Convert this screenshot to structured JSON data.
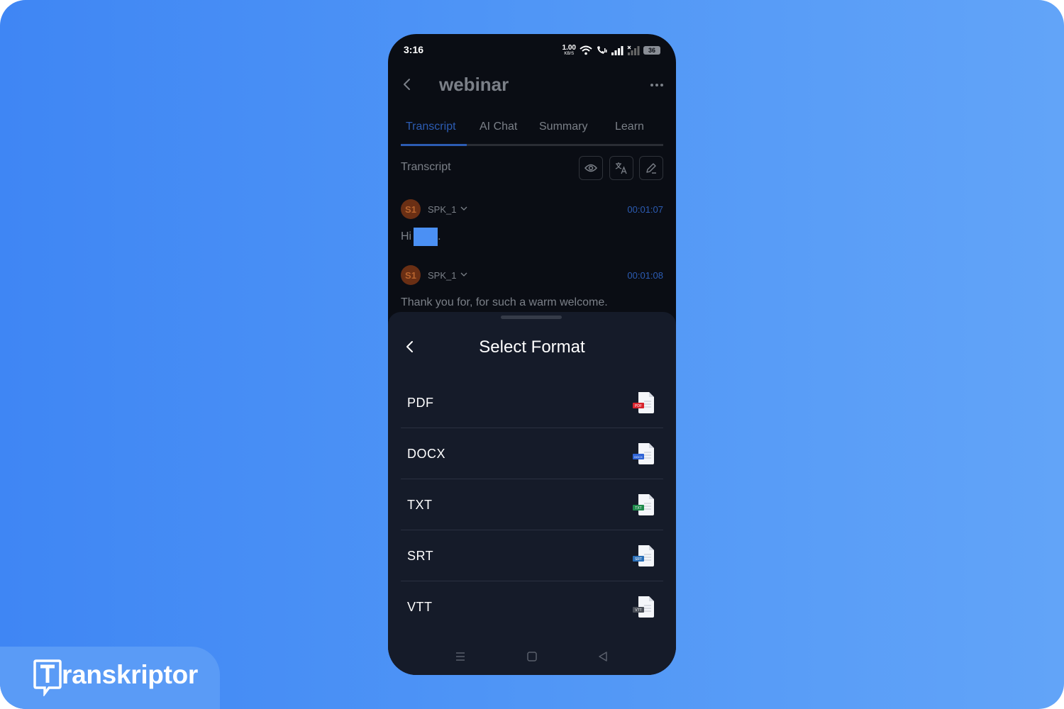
{
  "brand": {
    "name": "Transkriptor",
    "logo_letter": "T",
    "logo_rest": "ranskriptor"
  },
  "status_bar": {
    "time": "3:16",
    "net_speed": "1.00",
    "net_unit": "KB/S",
    "battery": "36"
  },
  "header": {
    "title": "webinar",
    "back_icon": "chevron-left-icon",
    "more_icon": "more-horizontal-icon"
  },
  "tabs": [
    {
      "label": "Transcript",
      "active": true
    },
    {
      "label": "AI Chat",
      "active": false
    },
    {
      "label": "Summary",
      "active": false
    },
    {
      "label": "Learn",
      "active": false
    }
  ],
  "transcript_section": {
    "label": "Transcript",
    "tools": [
      "eye-icon",
      "translate-icon",
      "edit-icon"
    ]
  },
  "entries": [
    {
      "avatar": "S1",
      "speaker": "SPK_1",
      "timestamp": "00:01:07",
      "text_before": "Hi",
      "text_after": ".",
      "redacted": true
    },
    {
      "avatar": "S1",
      "speaker": "SPK_1",
      "timestamp": "00:01:08",
      "text": "Thank you for, for such a warm welcome."
    }
  ],
  "sheet": {
    "title": "Select Format",
    "formats": [
      {
        "label": "PDF",
        "badge": "PDF",
        "badge_color": "#d8242d"
      },
      {
        "label": "DOCX",
        "badge": "DOCX",
        "badge_color": "#2f64d6"
      },
      {
        "label": "TXT",
        "badge": "TXT",
        "badge_color": "#1f8a4c"
      },
      {
        "label": "SRT",
        "badge": "SRT",
        "badge_color": "#2a6fb8"
      },
      {
        "label": "VTT",
        "badge": "VTT",
        "badge_color": "#4a4f58"
      }
    ]
  },
  "colors": {
    "accent": "#2c5cb3",
    "background_gradient_start": "#3f86f4",
    "background_gradient_end": "#62a4f8",
    "phone_bg": "#0a0d14",
    "sheet_bg": "#151b29"
  }
}
